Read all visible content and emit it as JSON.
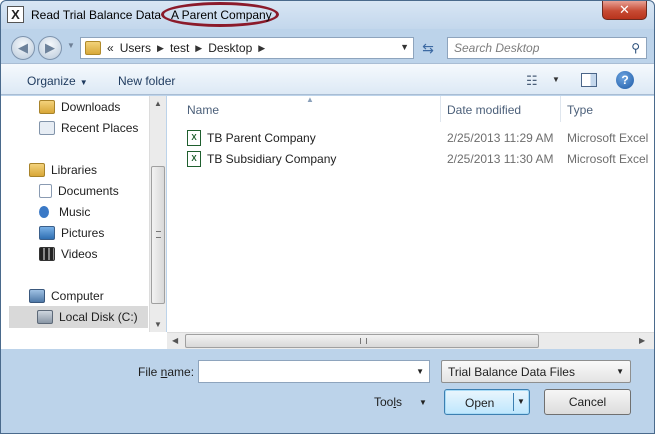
{
  "window": {
    "title": "Read Trial Balance Data",
    "company": "A Parent Company",
    "close_label": "✕"
  },
  "address": {
    "overflow": "«",
    "crumbs": [
      "Users",
      "test",
      "Desktop"
    ],
    "search_placeholder": "Search Desktop"
  },
  "toolbar": {
    "organize": "Organize",
    "new_folder": "New folder"
  },
  "navpane": {
    "items": [
      {
        "label": "Downloads",
        "icon": "downloads-icon"
      },
      {
        "label": "Recent Places",
        "icon": "recent-places-icon"
      },
      {
        "label": "Libraries",
        "icon": "libraries-icon"
      },
      {
        "label": "Documents",
        "icon": "documents-icon"
      },
      {
        "label": "Music",
        "icon": "music-icon"
      },
      {
        "label": "Pictures",
        "icon": "pictures-icon"
      },
      {
        "label": "Videos",
        "icon": "videos-icon"
      },
      {
        "label": "Computer",
        "icon": "computer-icon"
      },
      {
        "label": "Local Disk (C:)",
        "icon": "local-disk-icon"
      }
    ]
  },
  "filelist": {
    "columns": [
      "Name",
      "Date modified",
      "Type"
    ],
    "rows": [
      {
        "name": "TB Parent Company",
        "date": "2/25/2013 11:29 AM",
        "type": "Microsoft Excel"
      },
      {
        "name": "TB Subsidiary Company",
        "date": "2/25/2013 11:30 AM",
        "type": "Microsoft Excel"
      }
    ]
  },
  "footer": {
    "file_name_label_pre": "File ",
    "file_name_label_u": "n",
    "file_name_label_post": "ame:",
    "file_name_value": "",
    "file_type": "Trial Balance Data Files",
    "tools_pre": "Too",
    "tools_u": "l",
    "tools_post": "s",
    "open": "Open",
    "cancel": "Cancel"
  },
  "colors": {
    "highlight_ellipse": "#8b1a2a",
    "close_button": "#c74b34",
    "selection": "#d9d9d9"
  }
}
